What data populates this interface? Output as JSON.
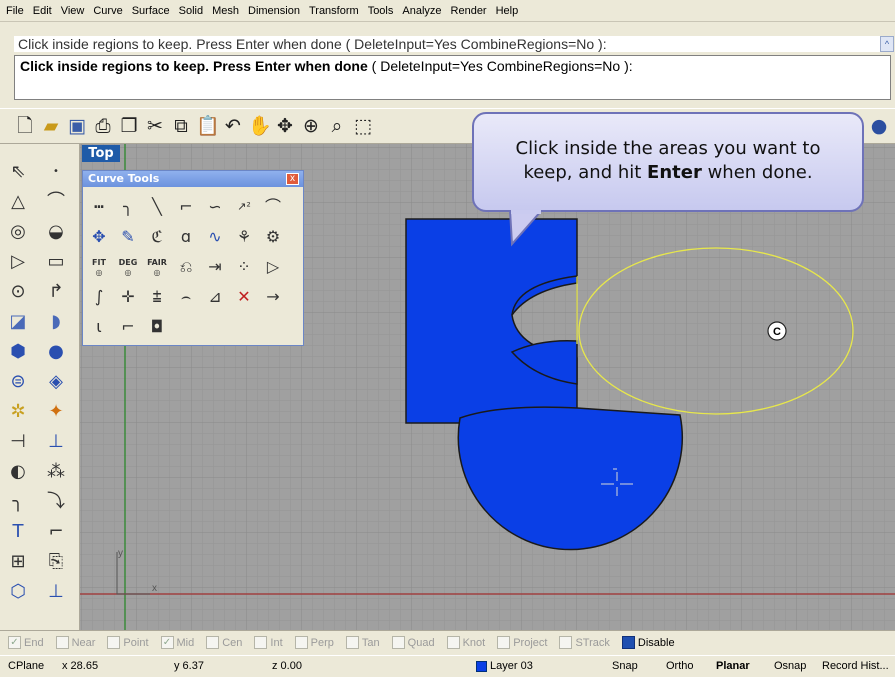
{
  "menu": [
    "File",
    "Edit",
    "View",
    "Curve",
    "Surface",
    "Solid",
    "Mesh",
    "Dimension",
    "Transform",
    "Tools",
    "Analyze",
    "Render",
    "Help"
  ],
  "command": {
    "history": "Click inside regions to keep. Press Enter when done ( DeleteInput=Yes  CombineRegions=No ):",
    "prompt_bold": "Click inside regions to keep. Press Enter when done",
    "prompt_options": "( DeleteInput=Yes  CombineRegions=No ):"
  },
  "toolbar_icons": [
    "new-file-icon",
    "open-folder-icon",
    "save-icon",
    "print-icon",
    "template-icon",
    "cut-icon",
    "copy-icon",
    "paste-icon",
    "undo-icon",
    "pan-hand-icon",
    "rotate-view-icon",
    "zoom-window-icon",
    "zoom-dynamic-icon",
    "zoom-extents-icon"
  ],
  "viewport": {
    "label": "Top",
    "axis_y": "y",
    "axis_x": "x"
  },
  "curve_tools": {
    "title": "Curve Tools",
    "close": "x",
    "fit_label": "FIT",
    "deg_label": "DEG",
    "fair_label": "FAIR"
  },
  "callout": {
    "line1": "Click inside the areas you want to",
    "line2_pre": "keep, and hit ",
    "line2_bold": "Enter",
    "line2_post": " when done."
  },
  "marker_label": "C",
  "osnap": {
    "items": [
      {
        "label": "End",
        "checked": true
      },
      {
        "label": "Near",
        "checked": false
      },
      {
        "label": "Point",
        "checked": false
      },
      {
        "label": "Mid",
        "checked": true
      },
      {
        "label": "Cen",
        "checked": false
      },
      {
        "label": "Int",
        "checked": false
      },
      {
        "label": "Perp",
        "checked": false
      },
      {
        "label": "Tan",
        "checked": false
      },
      {
        "label": "Quad",
        "checked": false
      },
      {
        "label": "Knot",
        "checked": false
      },
      {
        "label": "Project",
        "checked": false
      },
      {
        "label": "STrack",
        "checked": false
      }
    ],
    "disable_label": "Disable"
  },
  "status": {
    "cplane": "CPlane",
    "x": "x 28.65",
    "y": "y 6.37",
    "z": "z 0.00",
    "layer": "Layer 03",
    "snap": "Snap",
    "ortho": "Ortho",
    "planar": "Planar",
    "osnap": "Osnap",
    "record": "Record Hist..."
  },
  "colors": {
    "region_fill": "#0a3fe6",
    "curve_yellow": "#e8e84a",
    "viewport_bg": "#a0a0a0",
    "grid_line": "#969696",
    "x_axis": "#a04040",
    "y_axis": "#3a8a3a"
  }
}
